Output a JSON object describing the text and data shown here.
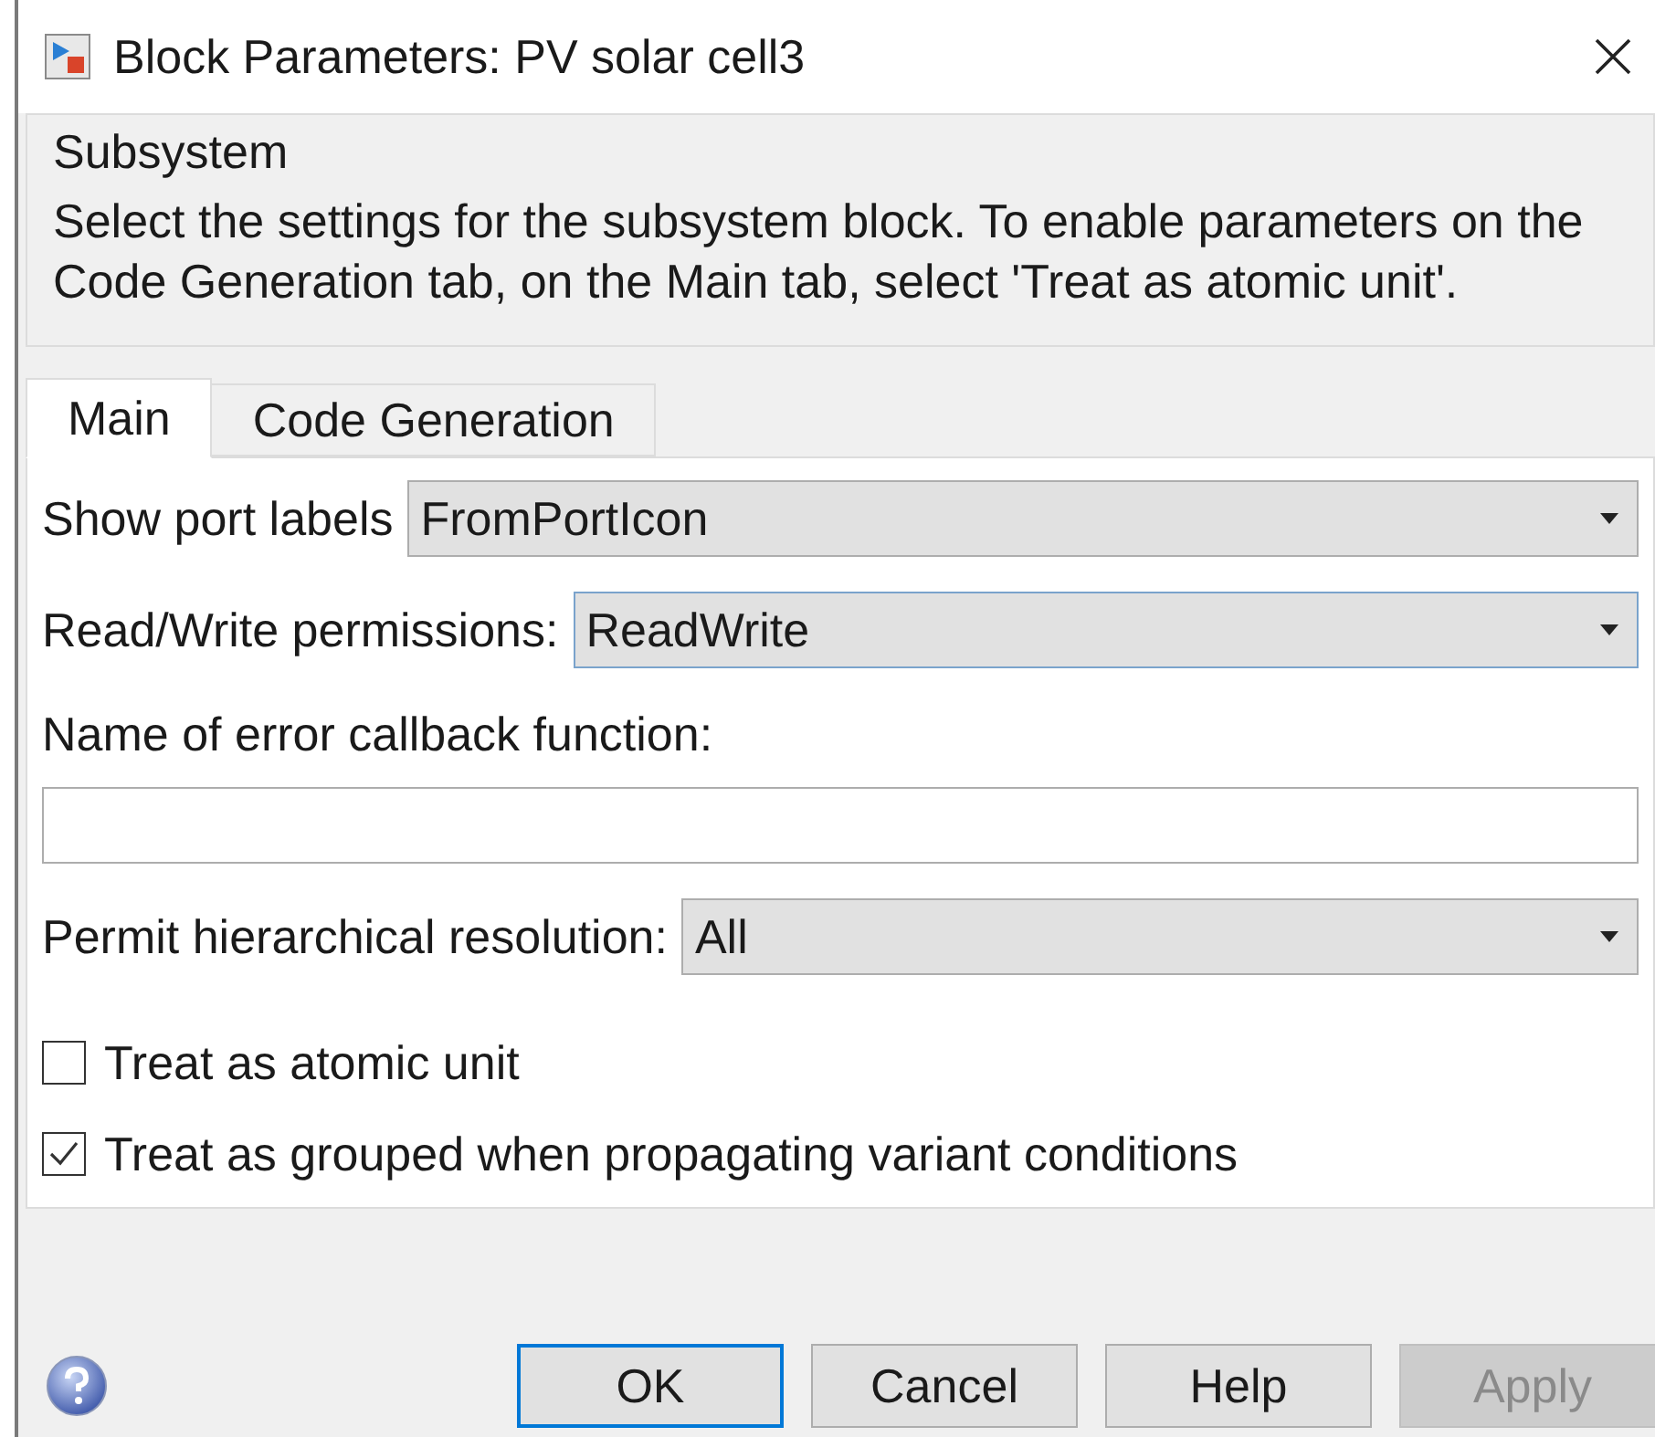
{
  "window": {
    "title": "Block Parameters: PV solar cell3"
  },
  "group": {
    "title": "Subsystem",
    "description": "Select the settings for the subsystem block. To enable parameters on the Code Generation tab, on the Main tab, select 'Treat as atomic unit'."
  },
  "tabs": [
    {
      "label": "Main",
      "selected": true
    },
    {
      "label": "Code Generation",
      "selected": false
    }
  ],
  "fields": [
    {
      "kind": "dropdown",
      "label": "Show port labels",
      "value": "FromPortIcon",
      "focused": false
    },
    {
      "kind": "dropdown",
      "label": "Read/Write permissions:",
      "value": "ReadWrite",
      "focused": true
    },
    {
      "kind": "text",
      "label": "Name of error callback function:",
      "focused": false
    },
    {
      "kind": "dropdown",
      "label": "Permit hierarchical resolution:",
      "value": "All",
      "focused": false
    }
  ],
  "checkboxes": [
    {
      "label": "Treat as atomic unit",
      "checked": false
    },
    {
      "label": "Treat as grouped when propagating variant conditions",
      "checked": true
    }
  ],
  "buttons": [
    {
      "label": "OK",
      "default": true,
      "disabled": false
    },
    {
      "label": "Cancel",
      "default": false,
      "disabled": false
    },
    {
      "label": "Help",
      "default": false,
      "disabled": false
    },
    {
      "label": "Apply",
      "default": false,
      "disabled": true
    }
  ]
}
